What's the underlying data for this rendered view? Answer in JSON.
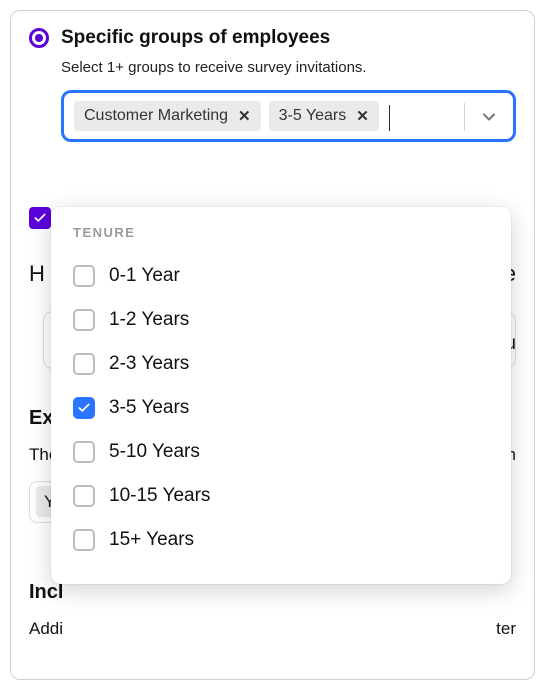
{
  "radio": {
    "label": "Specific groups of employees"
  },
  "subtext": "Select 1+ groups to receive survey invitations.",
  "selected_chips": [
    {
      "label": "Customer Marketing"
    },
    {
      "label": "3-5 Years"
    }
  ],
  "dropdown": {
    "section_header": "TENURE",
    "options": [
      {
        "label": "0-1 Year",
        "checked": false
      },
      {
        "label": "1-2 Years",
        "checked": false
      },
      {
        "label": "2-3 Years",
        "checked": false
      },
      {
        "label": "3-5 Years",
        "checked": true
      },
      {
        "label": "5-10 Years",
        "checked": false
      },
      {
        "label": "10-15 Years",
        "checked": false
      },
      {
        "label": "15+ Years",
        "checked": false
      }
    ]
  },
  "bg": {
    "h": "H",
    "te": "te",
    "gu": "gu",
    "excl": "Excl",
    "thes": "Thes",
    "noh": "o h",
    "y": "Y",
    "incl": "Incl",
    "addi": "Addi",
    "ter": "ter"
  }
}
